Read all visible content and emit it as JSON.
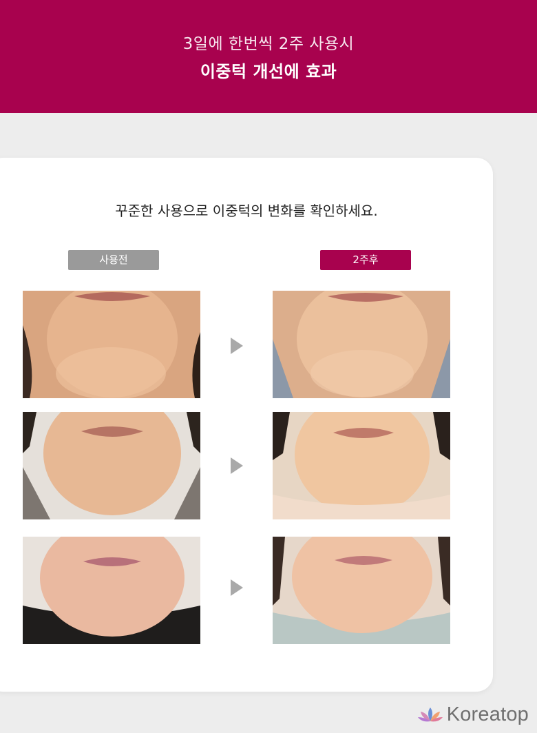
{
  "header": {
    "line1": "3일에 한번씩 2주 사용시",
    "line2": "이중턱 개선에 효과"
  },
  "card": {
    "subtitle": "꾸준한 사용으로 이중턱의 변화를 확인하세요.",
    "before_label": "사용전",
    "after_label": "2주후"
  },
  "brand": {
    "name": "Koreatop"
  },
  "colors": {
    "accent": "#a8024e",
    "before_label_bg": "#9a9a9a",
    "page_bg": "#ededed",
    "arrow": "#a9a9a9"
  }
}
